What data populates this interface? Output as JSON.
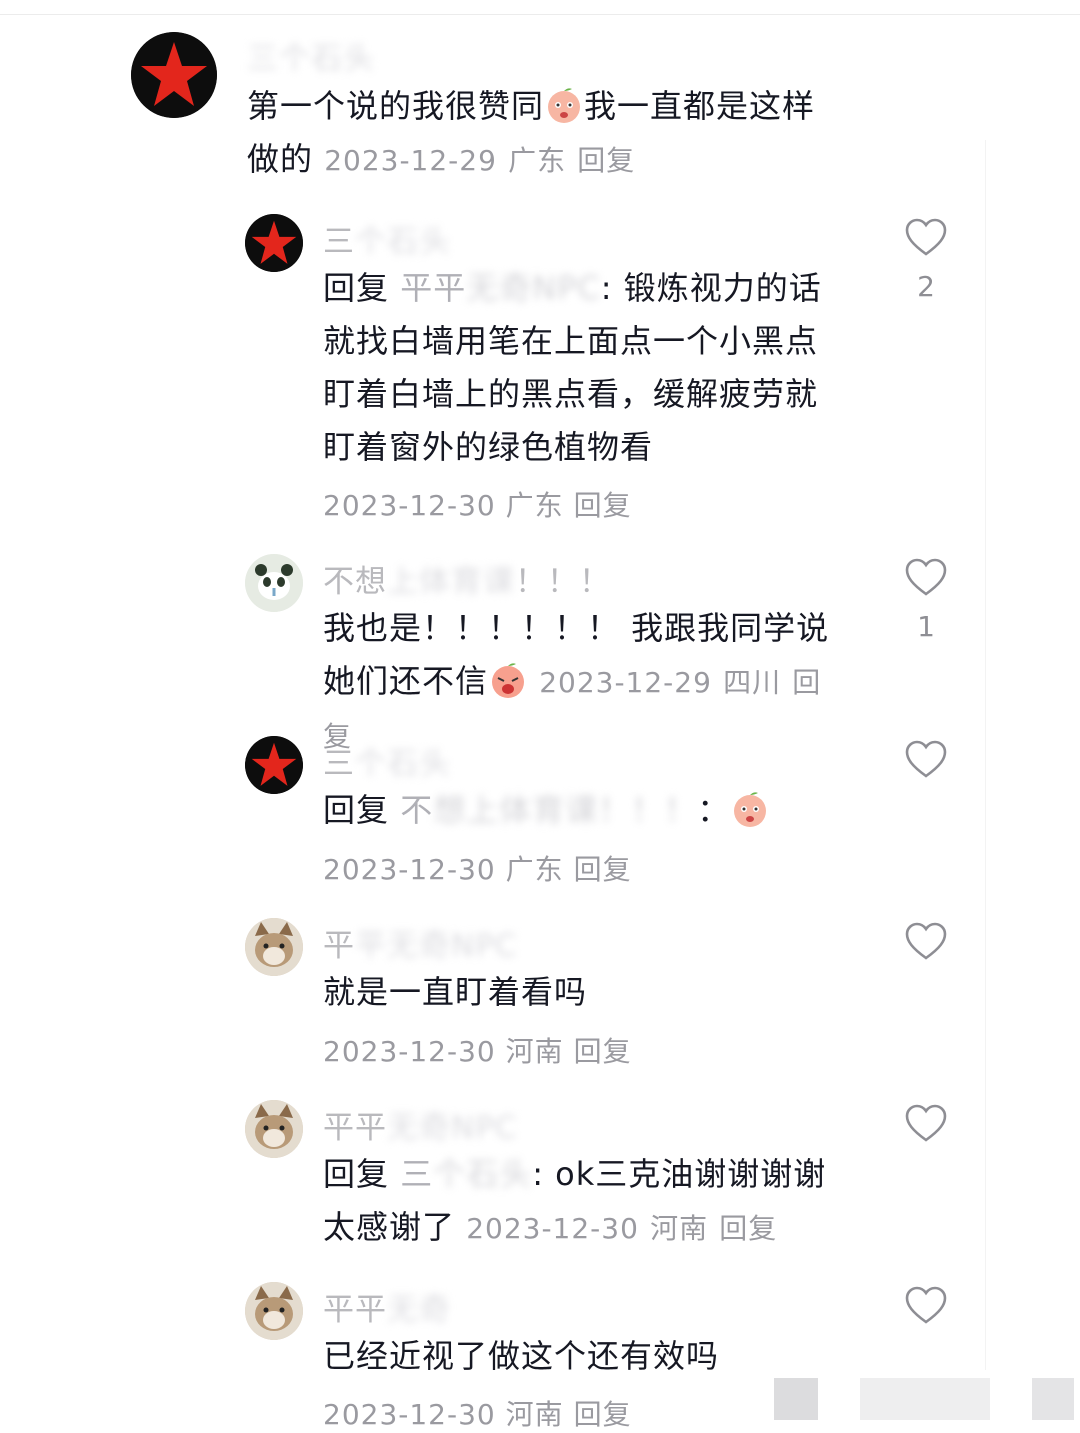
{
  "comments": [
    {
      "name_visible": "",
      "name_blur": "三个石头",
      "text_a": "第一个说的我很赞同",
      "text_b": "我一直都是这样做的",
      "date": "2023-12-29",
      "location": "广东",
      "reply": "回复",
      "avatar_icon": "red-star-icon"
    },
    {
      "name_visible": "三",
      "name_blur": "个石头",
      "reply_prefix": "回复",
      "reply_to_visible": "平平",
      "reply_to_blur": "无奇NPC",
      "text": ": 锻炼视力的话就找白墙用笔在上面点一个小黑点盯着白墙上的黑点看，缓解疲劳就盯着窗外的绿色植物看",
      "date": "2023-12-30",
      "location": "广东",
      "reply": "回复",
      "likes": "2",
      "avatar_icon": "red-star-icon"
    },
    {
      "name_visible": "不想",
      "name_blur": "上体育课",
      "name_tail": "！！！",
      "text_a": "我也是！！！！！！ 我跟我同学说",
      "text_b": "她们还不信",
      "date": "2023-12-29",
      "location": "四川",
      "reply": "回复",
      "likes": "1",
      "avatar_icon": "panda-icon"
    },
    {
      "name_visible": "三",
      "name_blur": "个石头",
      "reply_prefix": "回复",
      "reply_to_visible": "不",
      "reply_to_blur": "想上体育课！！！",
      "text": "：",
      "date": "2023-12-30",
      "location": "广东",
      "reply": "回复",
      "avatar_icon": "red-star-icon"
    },
    {
      "name_visible": "平",
      "name_blur": "平无奇NPC",
      "text": "就是一直盯着看吗",
      "date": "2023-12-30",
      "location": "河南",
      "reply": "回复",
      "avatar_icon": "cat-icon"
    },
    {
      "name_visible": "平平",
      "name_blur": "无奇NPC",
      "reply_prefix": "回复",
      "reply_to_visible": "三",
      "reply_to_blur": "个石头",
      "text_a": ": ok三克油谢谢谢谢",
      "text_b": "太感谢了",
      "date": "2023-12-30",
      "location": "河南",
      "reply": "回复",
      "avatar_icon": "cat-icon"
    },
    {
      "name_visible": "平平",
      "name_blur": "无奇",
      "text": "已经近视了做这个还有效吗",
      "date": "2023-12-30",
      "location": "河南",
      "reply": "回复",
      "avatar_icon": "cat-icon"
    }
  ],
  "icons": {
    "like": "heart-outline-icon",
    "emoji": "peach-face-emoji-icon"
  },
  "colors": {
    "text": "#161823",
    "meta": "#9a9aa0",
    "star_red": "#e3261c"
  }
}
